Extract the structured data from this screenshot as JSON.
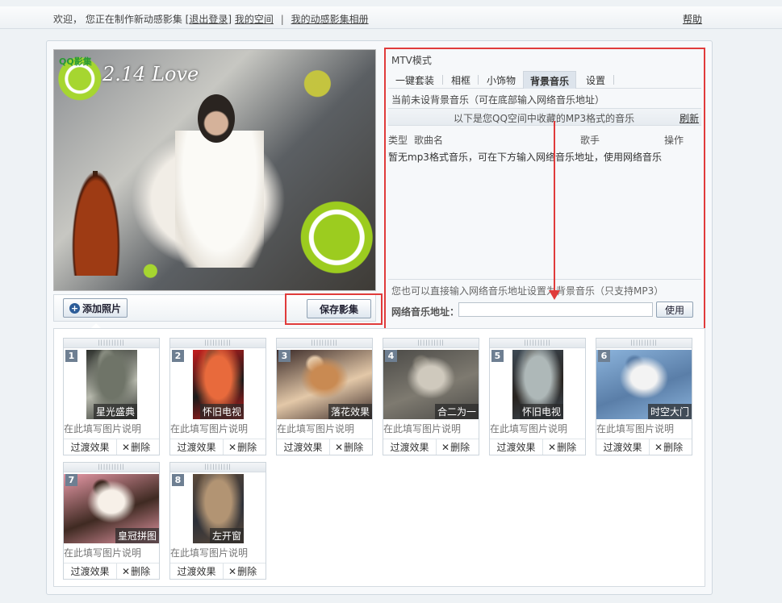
{
  "topbar": {
    "welcome": "欢迎，",
    "making_text": "您正在制作新动感影集 [",
    "logout": "退出登录",
    "making_end": "]",
    "my_space": "我的空间",
    "separator": "|",
    "my_album": "我的动感影集相册",
    "help": "帮助"
  },
  "preview": {
    "logo_text": "QQ影集",
    "overlay_title": "2.14 Love"
  },
  "toolbar": {
    "add_photo": "添加照片",
    "save_album": "保存影集"
  },
  "music": {
    "mode_title": "MTV模式",
    "tabs": [
      "一键套装",
      "相框",
      "小饰物",
      "背景音乐",
      "设置"
    ],
    "active_tab": "背景音乐",
    "status": "当前未设背景音乐（可在底部输入网络音乐地址）",
    "list_header": "以下是您QQ空间中收藏的MP3格式的音乐",
    "refresh": "刷新",
    "columns": {
      "type": "类型",
      "song": "歌曲名",
      "singer": "歌手",
      "action": "操作"
    },
    "empty_message": "暂无mp3格式音乐，可在下方输入网络音乐地址，使用网络音乐",
    "net_hint": "您也可以直接输入网络音乐地址设置为背景音乐（只支持MP3）",
    "net_label": "网络音乐地址：",
    "net_value": "",
    "use_button": "使用"
  },
  "photos": [
    {
      "num": "1",
      "label": "星光盛典",
      "desc": "在此填写图片说明",
      "transition": "过渡效果",
      "delete": "删除",
      "colors": [
        "#2c2f2b",
        "#6f7468",
        "#b7b9ad"
      ]
    },
    {
      "num": "2",
      "label": "怀旧电视",
      "desc": "在此填写图片说明",
      "transition": "过渡效果",
      "delete": "删除",
      "colors": [
        "#c41d1d",
        "#e86a3c",
        "#1a1a1a"
      ]
    },
    {
      "num": "3",
      "label": "落花效果",
      "desc": "在此填写图片说明",
      "transition": "过渡效果",
      "delete": "删除",
      "colors": [
        "#3a2a28",
        "#c98a52",
        "#e3c8a8"
      ]
    },
    {
      "num": "4",
      "label": "合二为一",
      "desc": "在此填写图片说明",
      "transition": "过渡效果",
      "delete": "删除",
      "colors": [
        "#4b4a47",
        "#cfc9bd",
        "#7e7a70"
      ]
    },
    {
      "num": "5",
      "label": "怀旧电视",
      "desc": "在此填写图片说明",
      "transition": "过渡效果",
      "delete": "删除",
      "colors": [
        "#3e4a55",
        "#aeb8b8",
        "#27221e"
      ]
    },
    {
      "num": "6",
      "label": "时空大门",
      "desc": "在此填写图片说明",
      "transition": "过渡效果",
      "delete": "删除",
      "colors": [
        "#8cb4dc",
        "#f3f3f3",
        "#5a7ea8"
      ]
    },
    {
      "num": "7",
      "label": "皇冠拼图",
      "desc": "在此填写图片说明",
      "transition": "过渡效果",
      "delete": "删除",
      "colors": [
        "#e89aa8",
        "#f7f0e8",
        "#3f2a22"
      ]
    },
    {
      "num": "8",
      "label": "左开窗",
      "desc": "在此填写图片说明",
      "transition": "过渡效果",
      "delete": "删除",
      "colors": [
        "#5c4a3a",
        "#b29473",
        "#2b2f38"
      ]
    }
  ],
  "colors": {
    "highlight_red": "#e03b3b",
    "tab_active_bg": "#dde4ec",
    "badge_bg": "#6e7f92"
  }
}
